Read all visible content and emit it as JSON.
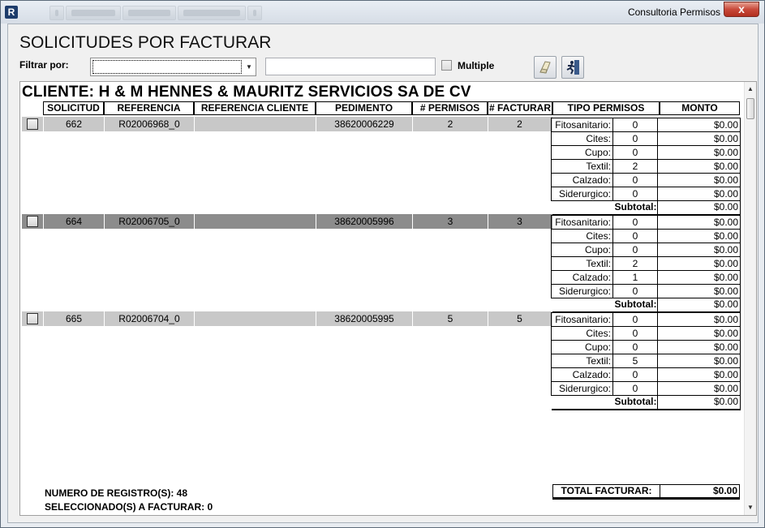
{
  "window": {
    "title": "Consultoria Permisos",
    "close_label": "x"
  },
  "page": {
    "title": "SOLICITUDES POR FACTURAR"
  },
  "filter": {
    "label": "Filtrar por:",
    "selected": "",
    "text_value": "",
    "multiple_label": "Multiple",
    "multiple_checked": false
  },
  "client": {
    "name": "CLIENTE: H & M HENNES & MAURITZ SERVICIOS SA DE CV"
  },
  "columns": {
    "solicitud": "SOLICITUD",
    "referencia": "REFERENCIA",
    "referencia_cliente": "REFERENCIA CLIENTE",
    "pedimento": "PEDIMENTO",
    "permisos": "# PERMISOS",
    "facturar": "# FACTURAR",
    "tipo_permisos": "TIPO PERMISOS",
    "monto": "MONTO"
  },
  "records": [
    {
      "solicitud": "662",
      "referencia": "R02006968_0",
      "referencia_cliente": "",
      "pedimento": "38620006229",
      "permisos": "2",
      "facturar": "2",
      "selected": false,
      "types": [
        {
          "tipo": "Fitosanitario:",
          "count": "0",
          "monto": "$0.00"
        },
        {
          "tipo": "Cites:",
          "count": "0",
          "monto": "$0.00"
        },
        {
          "tipo": "Cupo:",
          "count": "0",
          "monto": "$0.00"
        },
        {
          "tipo": "Textil:",
          "count": "2",
          "monto": "$0.00"
        },
        {
          "tipo": "Calzado:",
          "count": "0",
          "monto": "$0.00"
        },
        {
          "tipo": "Siderurgico:",
          "count": "0",
          "monto": "$0.00"
        }
      ],
      "subtotal_label": "Subtotal:",
      "subtotal": "$0.00"
    },
    {
      "solicitud": "664",
      "referencia": "R02006705_0",
      "referencia_cliente": "",
      "pedimento": "38620005996",
      "permisos": "3",
      "facturar": "3",
      "selected": false,
      "types": [
        {
          "tipo": "Fitosanitario:",
          "count": "0",
          "monto": "$0.00"
        },
        {
          "tipo": "Cites:",
          "count": "0",
          "monto": "$0.00"
        },
        {
          "tipo": "Cupo:",
          "count": "0",
          "monto": "$0.00"
        },
        {
          "tipo": "Textil:",
          "count": "2",
          "monto": "$0.00"
        },
        {
          "tipo": "Calzado:",
          "count": "1",
          "monto": "$0.00"
        },
        {
          "tipo": "Siderurgico:",
          "count": "0",
          "monto": "$0.00"
        }
      ],
      "subtotal_label": "Subtotal:",
      "subtotal": "$0.00"
    },
    {
      "solicitud": "665",
      "referencia": "R02006704_0",
      "referencia_cliente": "",
      "pedimento": "38620005995",
      "permisos": "5",
      "facturar": "5",
      "selected": false,
      "types": [
        {
          "tipo": "Fitosanitario:",
          "count": "0",
          "monto": "$0.00"
        },
        {
          "tipo": "Cites:",
          "count": "0",
          "monto": "$0.00"
        },
        {
          "tipo": "Cupo:",
          "count": "0",
          "monto": "$0.00"
        },
        {
          "tipo": "Textil:",
          "count": "5",
          "monto": "$0.00"
        },
        {
          "tipo": "Calzado:",
          "count": "0",
          "monto": "$0.00"
        },
        {
          "tipo": "Siderurgico:",
          "count": "0",
          "monto": "$0.00"
        }
      ],
      "subtotal_label": "Subtotal:",
      "subtotal": "$0.00"
    }
  ],
  "footer": {
    "registros": "NUMERO DE REGISTRO(S): 48",
    "seleccionados": "SELECCIONADO(S) A FACTURAR: 0",
    "total_label": "TOTAL FACTURAR:",
    "total_value": "$0.00"
  },
  "colors": {
    "row_light": "#c8c8c8",
    "row_dark": "#8c8c8c",
    "close_red": "#c8493a"
  }
}
